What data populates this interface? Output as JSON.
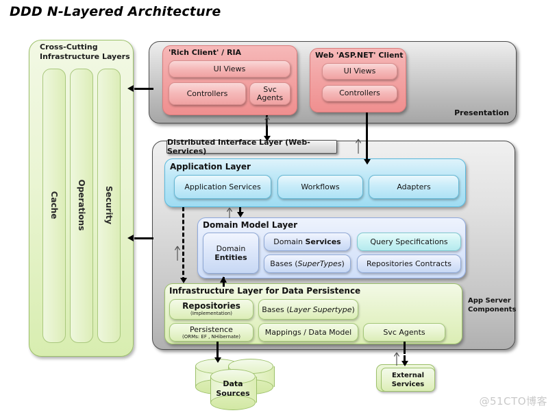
{
  "title": "DDD N-Layered Architecture",
  "watermark": "@51CTO博客",
  "cross_cutting": {
    "title": "Cross-Cutting\nInfrastructure Layers",
    "title_line1": "Cross-Cutting",
    "title_line2": "Infrastructure Layers",
    "columns": [
      {
        "label": "Cache"
      },
      {
        "label": "Operations"
      },
      {
        "label": "Security"
      }
    ]
  },
  "presentation": {
    "label": "Presentation",
    "rich_client": {
      "title": "'Rich Client' / RIA",
      "boxes": [
        {
          "label": "UI Views"
        },
        {
          "label": "Controllers"
        },
        {
          "label": "Svc Agents"
        }
      ]
    },
    "web_client": {
      "title": "Web 'ASP.NET' Client",
      "boxes": [
        {
          "label": "UI Views"
        },
        {
          "label": "Controllers"
        }
      ]
    }
  },
  "app_server": {
    "label_line1": "App Server",
    "label_line2": "Components",
    "distributed_interface_layer": "Distributed Interface Layer (Web-Services)",
    "application_layer": {
      "title": "Application Layer",
      "boxes": [
        {
          "label": "Application  Services"
        },
        {
          "label": "Workflows"
        },
        {
          "label": "Adapters"
        }
      ]
    },
    "domain_model_layer": {
      "title": "Domain Model Layer",
      "entities_line1": "Domain",
      "entities_line2": "Entities",
      "services_plain": "Domain ",
      "services_bold": "Services",
      "bases_plain": "Bases (",
      "bases_italic": "SuperTypes",
      "bases_tail": ")",
      "query_specifications": "Query Specifications",
      "repositories_contracts": "Repositories  Contracts"
    },
    "infrastructure_layer": {
      "title": "Infrastructure Layer for Data Persistence",
      "repositories_title": "Repositories",
      "repositories_sub": "(Implementation)",
      "bases_plain": "Bases (",
      "bases_italic": "Layer  Supertype",
      "bases_tail": ")",
      "persistence_title": "Persistence",
      "persistence_sub": "(ORMs: EF , NHibernate)",
      "mappings": "Mappings / Data Model",
      "svc_agents": "Svc Agents"
    }
  },
  "data_sources": {
    "label_line1": "Data",
    "label_line2": "Sources"
  },
  "external_services": {
    "label_line1": "External",
    "label_line2": "Services"
  },
  "colors": {
    "presentation_panel": "#c4c4c4",
    "client_pink": "#f3a6a6",
    "application_blue": "#bfe8f7",
    "domain_blue": "#dfe9fb",
    "query_cyan": "#cdf3f4",
    "infrastructure_green": "#e8f4cf",
    "cross_cutting_green": "#eaf5d3",
    "arrow_black": "#000000"
  }
}
